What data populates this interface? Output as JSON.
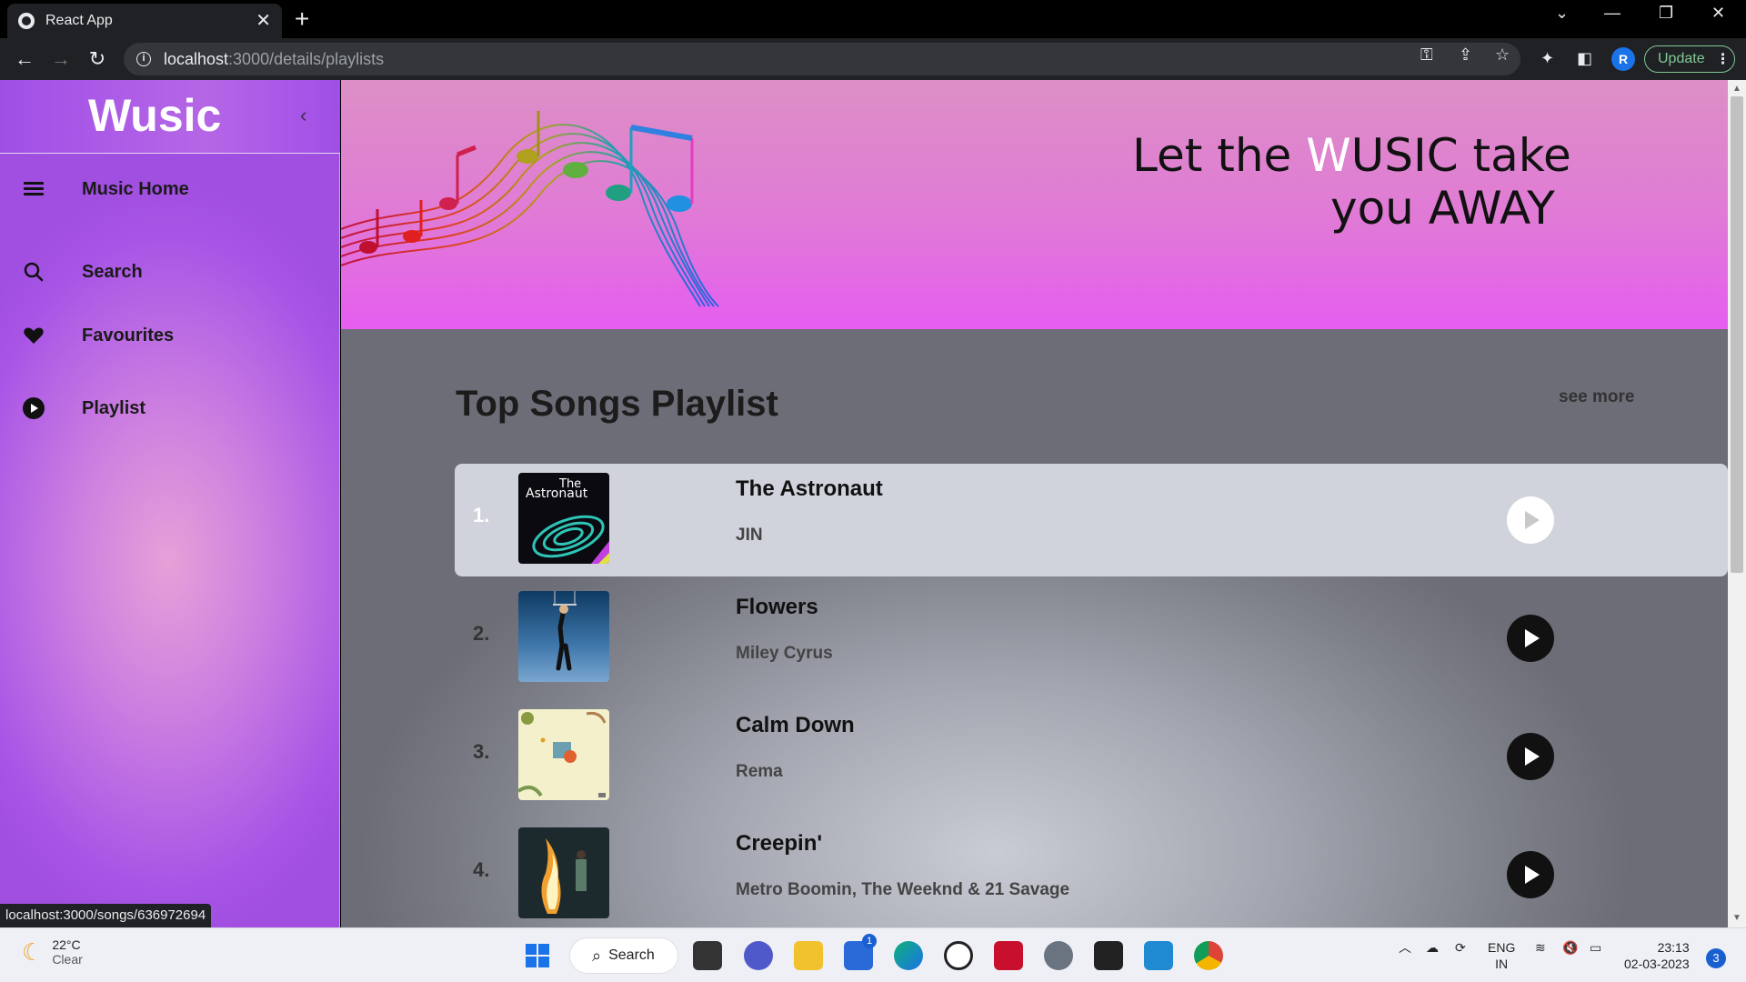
{
  "browser": {
    "tab_title": "React App",
    "tab_close": "✕",
    "new_tab": "+",
    "url_host": "localhost",
    "url_path": ":3000/details/playlists",
    "update_label": "Update",
    "profile_initial": "R",
    "status_url": "localhost:3000/songs/636972694"
  },
  "sidebar": {
    "logo": "Wusic",
    "collapse": "‹",
    "items": [
      {
        "label": "Music Home",
        "icon": "menu-icon"
      },
      {
        "label": "Search",
        "icon": "search-icon"
      },
      {
        "label": "Favourites",
        "icon": "heart-icon"
      },
      {
        "label": "Playlist",
        "icon": "play-circle-icon"
      }
    ]
  },
  "banner": {
    "tagline_pre": "Let the ",
    "tagline_w": "W",
    "tagline_post": "USIC take",
    "tagline_line2": "you AWAY"
  },
  "playlist": {
    "title": "Top Songs Playlist",
    "see_more": "see more",
    "songs": [
      {
        "num": "1.",
        "title": "The Astronaut",
        "artist": "JIN",
        "active": true
      },
      {
        "num": "2.",
        "title": "Flowers",
        "artist": "Miley Cyrus",
        "active": false
      },
      {
        "num": "3.",
        "title": "Calm Down",
        "artist": "Rema",
        "active": false
      },
      {
        "num": "4.",
        "title": "Creepin'",
        "artist": "Metro Boomin, The Weeknd & 21 Savage",
        "active": false
      }
    ],
    "astronaut_art_text_1": "The",
    "astronaut_art_text_2": "Astronaut"
  },
  "taskbar": {
    "temp": "22°C",
    "condition": "Clear",
    "search_label": "Search",
    "lang_1": "ENG",
    "lang_2": "IN",
    "time": "23:13",
    "date": "02-03-2023",
    "notif_count": "3",
    "store_badge": "1"
  },
  "colors": {
    "sidebar_purple": "#a855e6",
    "banner_pink": "#e55df0",
    "active_row": "#d0d3dc"
  }
}
